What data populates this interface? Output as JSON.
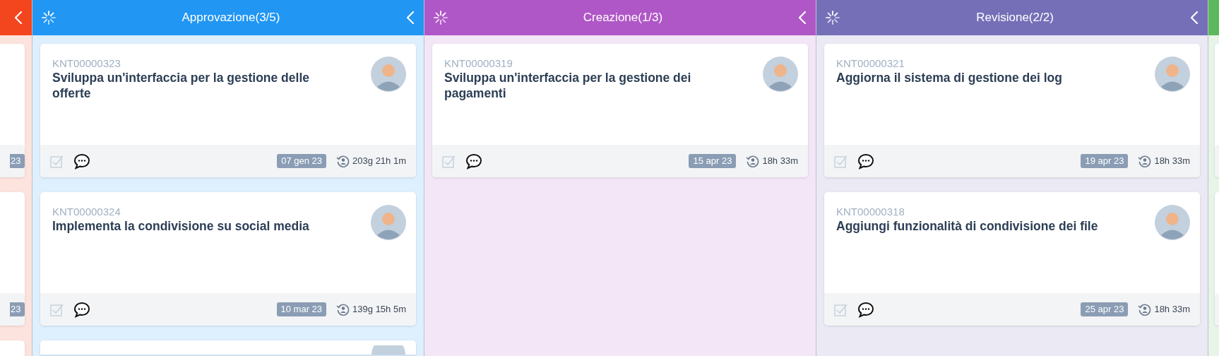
{
  "columns": [
    {
      "kind": "cut-left",
      "color": "#f4461e",
      "cards": [
        {
          "kind": "cut-side",
          "date": "23"
        },
        {
          "kind": "cut-side",
          "date": "23"
        },
        {
          "kind": "cut-side"
        }
      ]
    },
    {
      "kind": "full",
      "title": "Approvazione(3/5)",
      "color": "#2196f3",
      "cards": [
        {
          "kind": "full",
          "code": "KNT00000323",
          "title": "Sviluppa un'interfaccia per la gestione delle offerte",
          "date": "07 gen 23",
          "elapsed": "203g 21h 1m"
        },
        {
          "kind": "full",
          "code": "KNT00000324",
          "title": "Implementa la condivisione su social media",
          "date": "10 mar 23",
          "elapsed": "139g 15h 5m"
        },
        {
          "kind": "cut-bottom"
        }
      ]
    },
    {
      "kind": "full",
      "title": "Creazione(1/3)",
      "color": "#b057c7",
      "cards": [
        {
          "kind": "full",
          "code": "KNT00000319",
          "title": "Sviluppa un'interfaccia per la gestione dei pagamenti",
          "date": "15 apr 23",
          "elapsed": "18h 33m"
        }
      ]
    },
    {
      "kind": "full",
      "title": "Revisione(2/2)",
      "color": "#756fb8",
      "cards": [
        {
          "kind": "full",
          "code": "KNT00000321",
          "title": "Aggiorna il sistema di gestione dei log",
          "date": "19 apr 23",
          "elapsed": "18h 33m"
        },
        {
          "kind": "full",
          "code": "KNT00000318",
          "title": "Aggiungi funzionalità di condivisione dei file",
          "date": "25 apr 23",
          "elapsed": "18h 33m"
        }
      ]
    },
    {
      "kind": "cut-right",
      "color": "#5cb85c",
      "cards": [
        {
          "kind": "cut-side"
        },
        {
          "kind": "cut-side"
        }
      ]
    }
  ]
}
